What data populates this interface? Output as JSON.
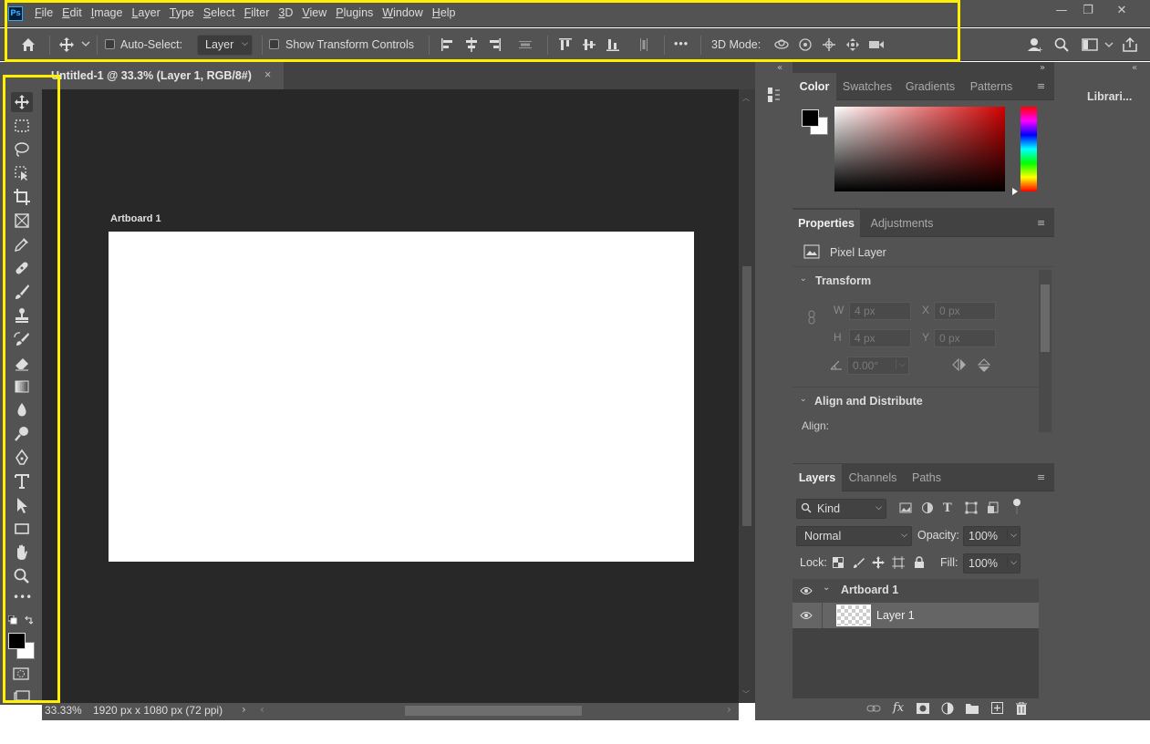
{
  "app": {
    "icon_label": "Ps"
  },
  "menu": [
    "File",
    "Edit",
    "Image",
    "Layer",
    "Type",
    "Select",
    "Filter",
    "3D",
    "View",
    "Plugins",
    "Window",
    "Help"
  ],
  "window_controls": {
    "minimize": "—",
    "restore": "❐",
    "close": "✕"
  },
  "options": {
    "auto_select_label": "Auto-Select:",
    "auto_select_value": "Layer",
    "show_transform_label": "Show Transform Controls",
    "more": "•••",
    "mode_3d_label": "3D Mode:"
  },
  "document": {
    "tab_title": "Untitled-1 @ 33.3% (Layer 1, RGB/8#)",
    "tab_close": "×",
    "artboard_label": "Artboard 1",
    "zoom": "33.33%",
    "doc_info": "1920 px x 1080 px (72 ppi)"
  },
  "color_panel": {
    "tabs": [
      "Color",
      "Swatches",
      "Gradients",
      "Patterns"
    ]
  },
  "properties_panel": {
    "tabs": [
      "Properties",
      "Adjustments"
    ],
    "layer_type": "Pixel Layer",
    "transform_title": "Transform",
    "w_label": "W",
    "w_value": "4 px",
    "h_label": "H",
    "h_value": "4 px",
    "x_label": "X",
    "x_value": "0 px",
    "y_label": "Y",
    "y_value": "0 px",
    "angle_value": "0.00°",
    "align_title": "Align and Distribute",
    "align_label": "Align:"
  },
  "layers_panel": {
    "tabs": [
      "Layers",
      "Channels",
      "Paths"
    ],
    "kind_label": "Kind",
    "blend_mode": "Normal",
    "opacity_label": "Opacity:",
    "opacity_value": "100%",
    "lock_label": "Lock:",
    "fill_label": "Fill:",
    "fill_value": "100%",
    "layers": [
      {
        "name": "Artboard 1",
        "type": "artboard"
      },
      {
        "name": "Layer 1",
        "type": "pixel",
        "selected": true
      }
    ]
  },
  "libraries_label": "Librari...",
  "colors": {
    "highlight": "#ffef00",
    "panel_bg": "#535353",
    "dark_bg": "#424242",
    "canvas_bg": "#282828"
  }
}
